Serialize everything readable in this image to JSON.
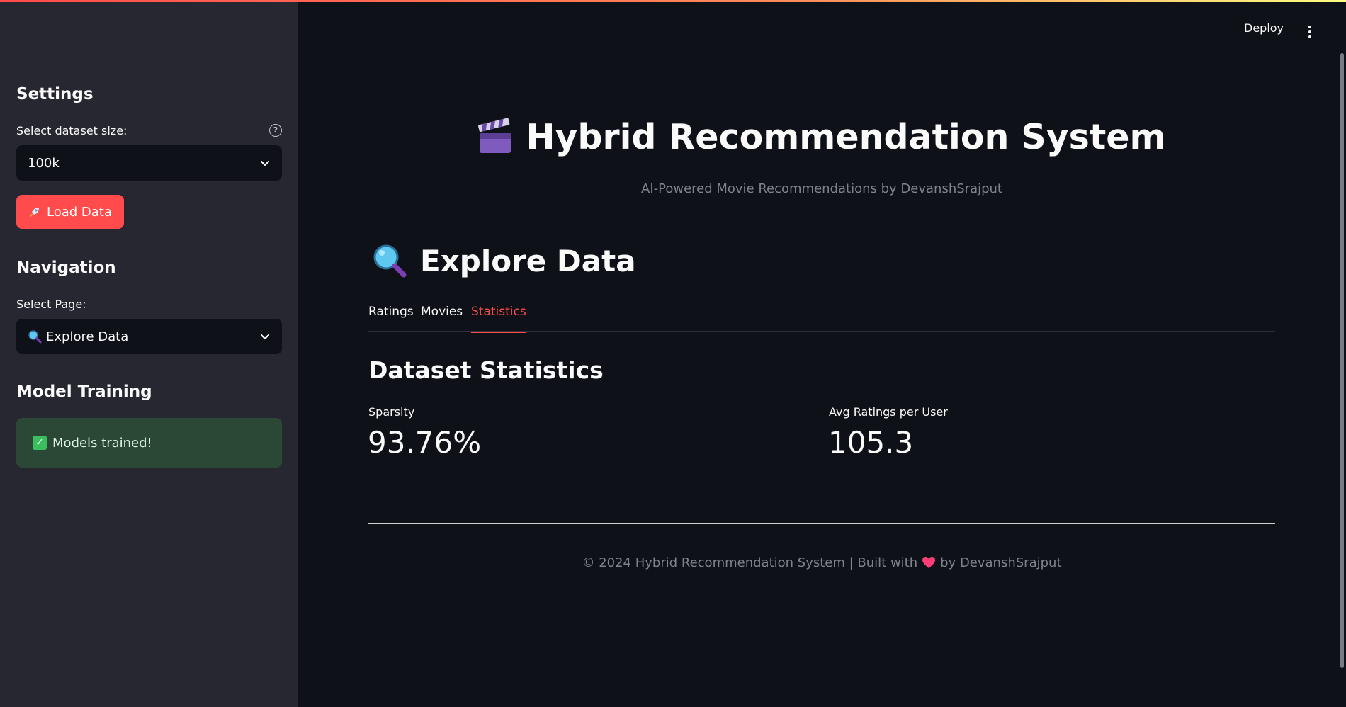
{
  "header": {
    "deploy_label": "Deploy",
    "menu_icon": "kebab-menu-icon",
    "accent_gradient": [
      "#ff4b4b",
      "#ff8c5a",
      "#fffd80"
    ]
  },
  "sidebar": {
    "settings_heading": "Settings",
    "dataset_label": "Select dataset size:",
    "dataset_help_icon": "question-circle-icon",
    "dataset_value": "100k",
    "load_button_label": "Load Data",
    "load_button_icon": "rocket-icon",
    "navigation_heading": "Navigation",
    "page_label": "Select Page:",
    "page_value": "Explore Data",
    "page_icon": "magnifier-icon",
    "model_heading": "Model Training",
    "model_status": "Models trained!",
    "model_status_icon": "check-icon"
  },
  "main": {
    "title": "Hybrid Recommendation System",
    "title_icon": "clapper-board-icon",
    "subtitle": "AI-Powered Movie Recommendations by DevanshSrajput",
    "section_title": "Explore Data",
    "section_icon": "magnifier-icon",
    "tabs": [
      {
        "label": "Ratings",
        "active": false
      },
      {
        "label": "Movies",
        "active": false
      },
      {
        "label": "Statistics",
        "active": true
      }
    ],
    "stats_title": "Dataset Statistics",
    "metrics": [
      {
        "label": "Sparsity",
        "value": "93.76%"
      },
      {
        "label": "Avg Ratings per User",
        "value": "105.3"
      }
    ],
    "footer_prefix": "© 2024 Hybrid Recommendation System | Built with",
    "footer_suffix": "by DevanshSrajput",
    "footer_icon": "heart-icon"
  },
  "colors": {
    "background": "#0e1117",
    "sidebar": "#262730",
    "accent": "#ff4b4b",
    "success_bg": "#2b4736"
  }
}
